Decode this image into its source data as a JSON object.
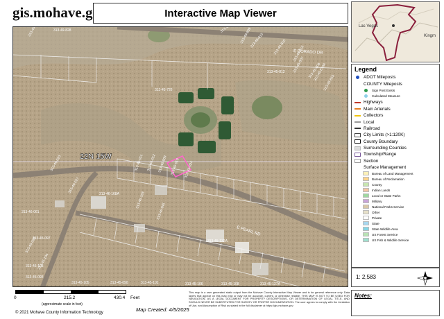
{
  "header": {
    "site_url": "gis.mohave.gov",
    "title": "Interactive Map Viewer"
  },
  "inset": {
    "place_label_1": "Las Vegas",
    "place_label_2": "Kingm"
  },
  "map": {
    "township_label": "22N 15W",
    "road_labels": [
      "E DORADO DR",
      "E PEARL RD"
    ],
    "parcel_labels": [
      "313-49-827",
      "313-49-828",
      "313-45-806",
      "313-49-809",
      "313-49-810",
      "313-45-810",
      "313-49-813",
      "313-45-812",
      "313-45-807",
      "313-45-808",
      "313-45-815",
      "313-45-816A",
      "313-45-726",
      "313-46-011",
      "313-46-012",
      "313-46-009",
      "313-46-010",
      "313-46-024",
      "313-46-168A",
      "313-46-023",
      "313-46-027",
      "313-46-193",
      "313-46-045",
      "313-46-061",
      "313-45-097",
      "313-45-095",
      "313-45-104",
      "313-45-103",
      "313-45-093",
      "313-45-105",
      "313-45-090",
      "313-45-101",
      "313-45-106",
      "313-45-108",
      "313-45-127A",
      "313-45-132A"
    ]
  },
  "legend": {
    "title": "Legend",
    "items": [
      {
        "label": "ADOT Mileposts",
        "kind": "dot",
        "color": "#1f4fbf",
        "style": "row"
      },
      {
        "label": "COUNTY Mileposts",
        "kind": "none",
        "color": "",
        "style": "row"
      },
      {
        "label": "Sign Post Exists",
        "kind": "dot",
        "color": "#2e9a4a",
        "style": "small"
      },
      {
        "label": "Calculated Measure",
        "kind": "dot",
        "color": "#8fd0e8",
        "style": "small"
      },
      {
        "label": "Highways",
        "kind": "line",
        "color": "#c0392b",
        "style": "row"
      },
      {
        "label": "Main Arterials",
        "kind": "line",
        "color": "#e67e22",
        "style": "row"
      },
      {
        "label": "Collectors",
        "kind": "line",
        "color": "#f1c40f",
        "style": "row"
      },
      {
        "label": "Local",
        "kind": "line",
        "color": "#999999",
        "style": "row"
      },
      {
        "label": "Railroad",
        "kind": "line",
        "color": "#333333",
        "style": "row"
      },
      {
        "label": "City Limits (>1:120K)",
        "kind": "box",
        "color": "#444444",
        "style": "row"
      },
      {
        "label": "County Boundary",
        "kind": "box",
        "color": "#111111",
        "style": "row"
      },
      {
        "label": "Surrounding Counties",
        "kind": "fill",
        "color": "#dddddd",
        "style": "row"
      },
      {
        "label": "Township/Range",
        "kind": "box",
        "color": "#7a5a9a",
        "style": "row"
      },
      {
        "label": "Section",
        "kind": "box",
        "color": "#9a9a9a",
        "style": "row"
      },
      {
        "label": "Surface Management",
        "kind": "none",
        "color": "",
        "style": "row"
      },
      {
        "label": "Bureau of Land Management",
        "kind": "fill",
        "color": "#fdf1b8",
        "style": "sub"
      },
      {
        "label": "Bureau of Reclamation",
        "kind": "fill",
        "color": "#ffd48a",
        "style": "sub"
      },
      {
        "label": "County",
        "kind": "fill",
        "color": "#c8e6b0",
        "style": "sub"
      },
      {
        "label": "Indian Lands",
        "kind": "fill",
        "color": "#f5c7a3",
        "style": "sub"
      },
      {
        "label": "Local or State Parks",
        "kind": "fill",
        "color": "#9fd8a0",
        "style": "sub"
      },
      {
        "label": "Military",
        "kind": "fill",
        "color": "#c9a4d9",
        "style": "sub"
      },
      {
        "label": "National Parks Service",
        "kind": "fill",
        "color": "#d9c7a6",
        "style": "sub"
      },
      {
        "label": "Other",
        "kind": "fill",
        "color": "#e6e0c9",
        "style": "sub"
      },
      {
        "label": "Private",
        "kind": "fill",
        "color": "#ffffff",
        "style": "sub"
      },
      {
        "label": "State",
        "kind": "fill",
        "color": "#a7d8f0",
        "style": "sub"
      },
      {
        "label": "State Wildlife Area",
        "kind": "fill",
        "color": "#84d6e6",
        "style": "sub"
      },
      {
        "label": "US Forest Service",
        "kind": "fill",
        "color": "#b9e3b4",
        "style": "sub"
      },
      {
        "label": "US Fish & Wildlife Service",
        "kind": "fill",
        "color": "#9fe1cf",
        "style": "sub"
      }
    ]
  },
  "scale": {
    "ratio": "1: 2,583",
    "bar_labels": [
      "0",
      "215.2",
      "430.4"
    ],
    "units_label": "Feet",
    "approx_label": "(approximate scale in feet)"
  },
  "footer": {
    "copyright": "© 2021 Mohave County Information Technology",
    "map_created": "Map Created: 4/5/2025",
    "disclaimer": "This map is a user generated static output from the Mohave County Interactive Map Viewer and is for general reference only. Data layers that appear on this map may or may not be accurate, current, or otherwise reliable. THIS MAP IS NOT TO BE USED FOR NAVIGATION, AS A LEGAL DOCUMENT FOR PROPERTY DESCRIPTIONS, OR DETERMINATION OF LEGAL TITLE, AND SHOULD NEVER BE SUBSTITUTED FOR SURVEY OR PROPER DOCUMENTATION. The user agrees to comply with the Limitation of Use, and Assumption of Risk as stated in the full disclaimer at https://gis.mohave.gov.",
    "notes_label": "Notes:"
  },
  "colors": {
    "terrain": "#b9a68b",
    "road": "#8c8174",
    "parcel_line": "#f2f2f2",
    "selected_parcel": "#ff66cc",
    "pond": "#2f5a34"
  }
}
